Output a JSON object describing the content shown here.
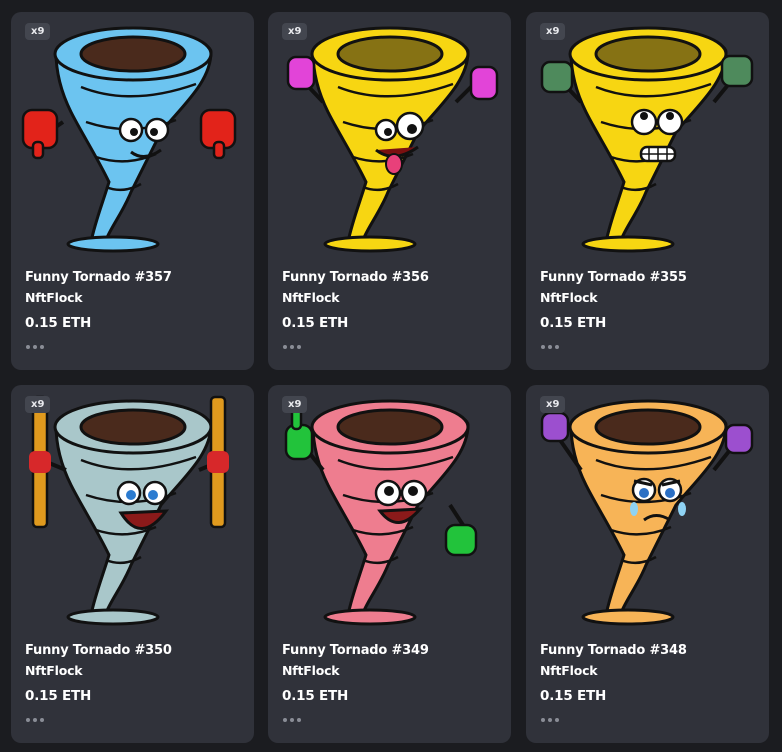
{
  "cards": [
    {
      "badge": "x9",
      "title": "Funny Tornado #357",
      "creator": "NftFlock",
      "price": "0.15 ETH",
      "body_color": "#6cc4f0",
      "accent_color": "#e2231a",
      "icon": "tornado-arms-down-icon"
    },
    {
      "badge": "x9",
      "title": "Funny Tornado #356",
      "creator": "NftFlock",
      "price": "0.15 ETH",
      "body_color": "#f7d612",
      "accent_color": "#e244d8",
      "icon": "tornado-tongue-icon"
    },
    {
      "badge": "x9",
      "title": "Funny Tornado #355",
      "creator": "NftFlock",
      "price": "0.15 ETH",
      "body_color": "#f7d612",
      "accent_color": "#4e8a5c",
      "icon": "tornado-scared-icon"
    },
    {
      "badge": "x9",
      "title": "Funny Tornado #350",
      "creator": "NftFlock",
      "price": "0.15 ETH",
      "body_color": "#a9c7ca",
      "accent_color": "#e09a1e",
      "icon": "tornado-fries-icon"
    },
    {
      "badge": "x9",
      "title": "Funny Tornado #349",
      "creator": "NftFlock",
      "price": "0.15 ETH",
      "body_color": "#ee7d8f",
      "accent_color": "#22c33b",
      "icon": "tornado-pointing-icon"
    },
    {
      "badge": "x9",
      "title": "Funny Tornado #348",
      "creator": "NftFlock",
      "price": "0.15 ETH",
      "body_color": "#f7b457",
      "accent_color": "#9c4fcf",
      "icon": "tornado-crying-icon"
    }
  ]
}
